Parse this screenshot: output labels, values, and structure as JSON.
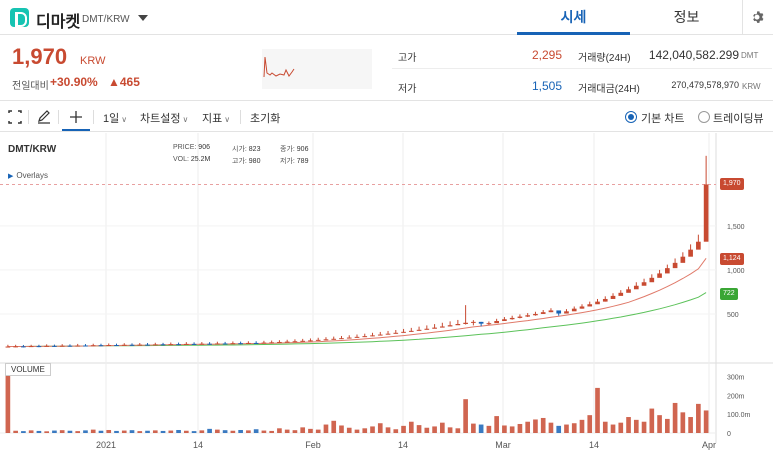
{
  "header": {
    "coin_name": "디마켓",
    "pair": "DMT/KRW",
    "tabs": [
      {
        "label": "시세",
        "active": true
      },
      {
        "label": "정보",
        "active": false
      }
    ]
  },
  "price": {
    "current": "1,970",
    "unit": "KRW",
    "change_label": "전일대비",
    "change_rate": "+30.90%",
    "change_amount": "▲465",
    "up_color": "#c84a31",
    "down_color": "#1763b6"
  },
  "stats": {
    "high_label": "고가",
    "high_value": "2,295",
    "low_label": "저가",
    "low_value": "1,505",
    "volume_label": "거래량(24H)",
    "volume_value": "142,040,582.299",
    "volume_unit": "DMT",
    "amount_label": "거래대금(24H)",
    "amount_value": "270,479,578,970",
    "amount_unit": "KRW"
  },
  "toolbar": {
    "interval": "1일",
    "chart_settings": "차트설정",
    "indicators": "지표",
    "reset": "초기화",
    "basic_chart": "기본 차트",
    "tradingview": "트레이딩뷰",
    "icons": [
      "expand-icon",
      "draw-pencil-icon",
      "crosshair-icon"
    ]
  },
  "chart_info": {
    "symbol": "DMT/KRW",
    "overlays": "Overlays",
    "price_label": "PRICE:",
    "price_value": "906",
    "open_label": "시가:",
    "open_value": "823",
    "close_label": "종가:",
    "close_value": "906",
    "vol_label": "VOL:",
    "vol_value": "25.2M",
    "high_label": "고가:",
    "high_value": "980",
    "low_label": "저가:",
    "low_value": "789",
    "volume_pane_label": "VOLUME"
  },
  "chart_data": {
    "type": "candlestick",
    "x_tick_labels": [
      "2021",
      "14",
      "Feb",
      "14",
      "Mar",
      "14",
      "Apr"
    ],
    "y_tick_labels": [
      "1,500",
      "1,000",
      "500"
    ],
    "y_ticks": [
      1500,
      1000,
      500
    ],
    "ylim": [
      0,
      2100
    ],
    "volume_tick_labels": [
      "300m",
      "200m",
      "100.0m",
      "0"
    ],
    "volume_ticks": [
      300,
      200,
      100,
      0
    ],
    "volume_ylim": [
      0,
      330
    ],
    "price_tags": [
      {
        "label": "1,970",
        "value": 1970,
        "color": "#c84a31"
      },
      {
        "label": "1,124",
        "value": 1124,
        "color": "#c84a31"
      },
      {
        "label": "722",
        "value": 722,
        "color": "#3aa635"
      }
    ],
    "dashed_line_value": 1970,
    "ma_short_color": "#e07a6a",
    "ma_long_color": "#5cc25a",
    "close": [
      130,
      132,
      130,
      135,
      133,
      138,
      136,
      140,
      138,
      142,
      141,
      145,
      144,
      147,
      146,
      150,
      149,
      152,
      151,
      155,
      154,
      157,
      156,
      160,
      159,
      162,
      161,
      165,
      164,
      168,
      167,
      171,
      170,
      175,
      178,
      182,
      186,
      190,
      195,
      200,
      206,
      212,
      218,
      225,
      232,
      240,
      248,
      257,
      266,
      276,
      286,
      297,
      308,
      320,
      332,
      345,
      358,
      372,
      386,
      400,
      410,
      390,
      395,
      420,
      440,
      455,
      470,
      485,
      500,
      520,
      540,
      505,
      530,
      560,
      585,
      610,
      640,
      670,
      705,
      740,
      780,
      820,
      860,
      910,
      960,
      1020,
      1080,
      1150,
      1230,
      1320,
      1970
    ],
    "high": [
      150,
      150,
      148,
      150,
      150,
      155,
      152,
      157,
      155,
      160,
      158,
      162,
      162,
      165,
      163,
      168,
      166,
      170,
      170,
      173,
      172,
      176,
      175,
      180,
      178,
      181,
      180,
      185,
      183,
      188,
      186,
      190,
      190,
      195,
      198,
      202,
      207,
      212,
      217,
      222,
      230,
      236,
      243,
      250,
      258,
      267,
      276,
      286,
      296,
      307,
      318,
      330,
      342,
      356,
      370,
      385,
      400,
      416,
      432,
      600,
      430,
      410,
      415,
      445,
      465,
      480,
      495,
      510,
      525,
      545,
      565,
      530,
      555,
      585,
      610,
      640,
      670,
      700,
      735,
      770,
      810,
      860,
      900,
      950,
      1000,
      1060,
      1130,
      1200,
      1290,
      1400,
      2295
    ],
    "low": [
      120,
      122,
      120,
      125,
      123,
      128,
      126,
      130,
      128,
      132,
      131,
      135,
      134,
      137,
      136,
      140,
      139,
      142,
      141,
      145,
      144,
      147,
      146,
      150,
      149,
      152,
      151,
      155,
      154,
      158,
      157,
      161,
      160,
      165,
      168,
      172,
      176,
      180,
      185,
      190,
      196,
      202,
      208,
      215,
      222,
      230,
      238,
      247,
      256,
      266,
      276,
      287,
      298,
      310,
      322,
      335,
      348,
      362,
      376,
      380,
      370,
      360,
      375,
      400,
      420,
      435,
      450,
      465,
      480,
      500,
      520,
      480,
      505,
      535,
      560,
      585,
      615,
      640,
      675,
      710,
      745,
      785,
      825,
      870,
      920,
      975,
      1035,
      1100,
      1175,
      1260,
      1505
    ],
    "volume": [
      320,
      12,
      10,
      14,
      11,
      9,
      13,
      15,
      12,
      10,
      14,
      18,
      12,
      16,
      11,
      13,
      15,
      10,
      12,
      14,
      11,
      13,
      16,
      12,
      10,
      14,
      22,
      18,
      15,
      12,
      16,
      14,
      20,
      13,
      11,
      25,
      18,
      15,
      30,
      22,
      18,
      45,
      65,
      40,
      28,
      18,
      25,
      35,
      52,
      30,
      20,
      38,
      60,
      42,
      28,
      35,
      55,
      30,
      25,
      180,
      50,
      45,
      38,
      90,
      40,
      35,
      48,
      60,
      72,
      80,
      55,
      38,
      45,
      52,
      70,
      95,
      240,
      60,
      45,
      55,
      85,
      70,
      60,
      130,
      95,
      75,
      160,
      110,
      85,
      155,
      120
    ]
  }
}
